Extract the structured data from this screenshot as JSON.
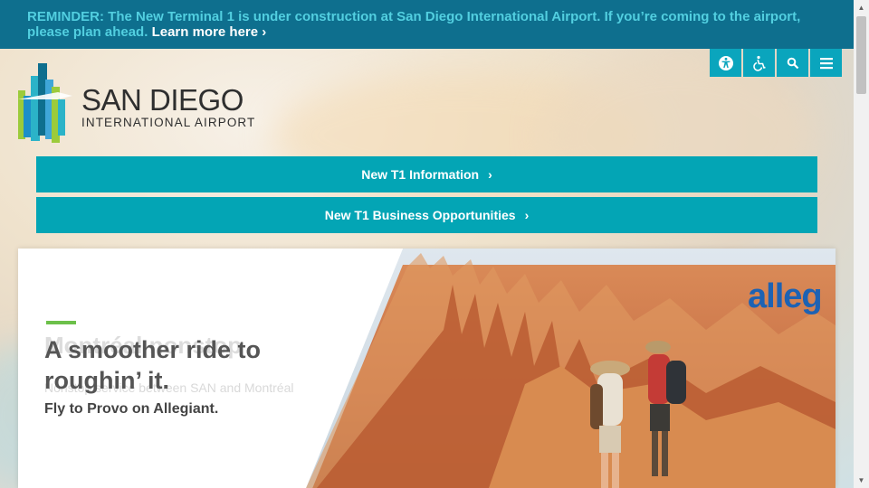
{
  "alert": {
    "label": "REMINDER:",
    "message": "The New Terminal 1 is under construction at San Diego International Airport. If you’re coming to the airport, please plan ahead.",
    "link": "Learn more here ›"
  },
  "utility_icons": [
    "accessibility-icon",
    "wheelchair-icon",
    "search-icon",
    "menu-icon"
  ],
  "logo": {
    "line1": "SAN DIEGO",
    "line2": "INTERNATIONAL AIRPORT"
  },
  "buttons": [
    {
      "label": "New T1 Information",
      "chevron": "›"
    },
    {
      "label": "New T1 Business Opportunities",
      "chevron": "›"
    }
  ],
  "hero": {
    "ghost_title": "Montréal nonstop",
    "ghost_sub": "Nonstop service between SAN and Montréal",
    "title_line1": "A smoother ride to",
    "title_line2": "roughin’ it.",
    "subtitle": "Fly to Provo on Allegiant.",
    "brand": "alleg"
  },
  "colors": {
    "alert_bg": "#0e6f8e",
    "alert_text": "#52cfe0",
    "accent_teal": "#03a5b5",
    "accent_green": "#6cc04a",
    "allegiant_blue": "#1d62b3"
  }
}
